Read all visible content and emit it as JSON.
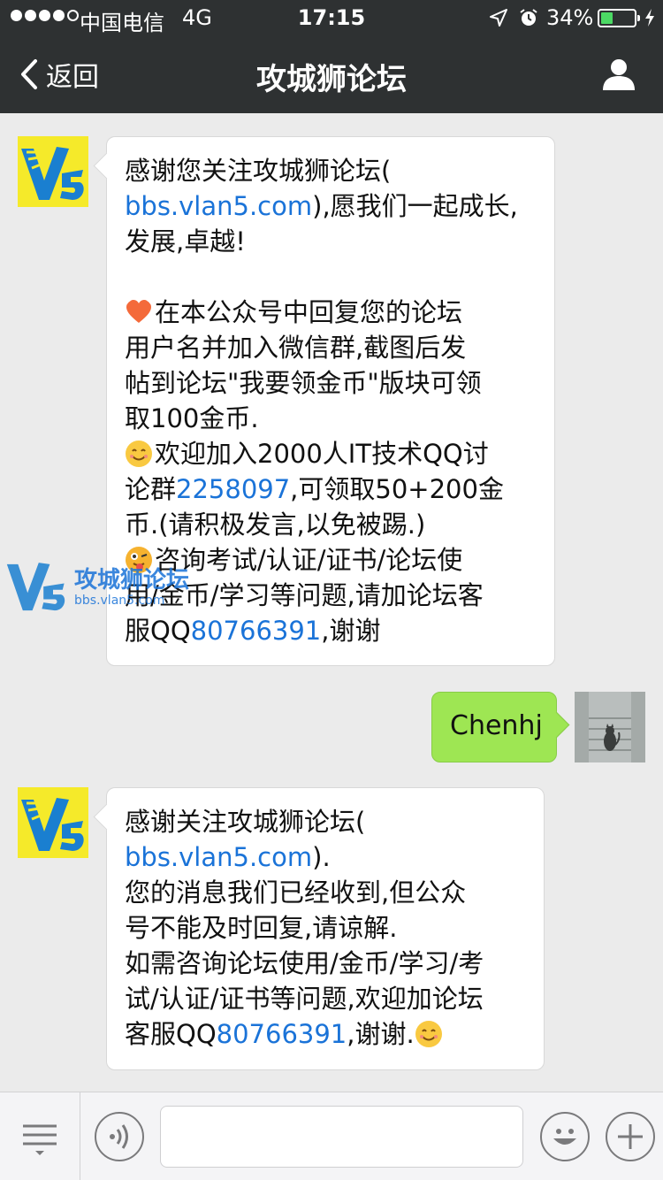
{
  "status_bar": {
    "carrier": "中国电信",
    "network": "4G",
    "time": "17:15",
    "battery_percent": "34%",
    "battery_level": 0.34,
    "battery_color": "#4cd964"
  },
  "nav": {
    "back_label": "返回",
    "title": "攻城狮论坛",
    "back_icon": "chevron-left-icon",
    "profile_icon": "person-icon"
  },
  "messages": {
    "msg1": {
      "sender": "official-account",
      "line1": "感谢您关注攻城狮论坛(",
      "line2_link": "bbs.vlan5.com",
      "line2_rest": "),愿我们一起成长,",
      "line3": "发展,卓越!",
      "p2_line1": "在本公众号中回复您的论坛",
      "p2_line2": "用户名并加入微信群,截图后发",
      "p2_line3": "帖到论坛\"我要领金币\"版块可领",
      "p2_line4": "取100金币.",
      "p3_line1": "欢迎加入2000人IT技术QQ讨",
      "p3_line2_pre": "论群",
      "p3_line2_link": "2258097",
      "p3_line2_rest": ",可领取50+200金",
      "p3_line3": "币.(请积极发言,以免被踢.)",
      "p4_line1": "咨询考试/认证/证书/论坛使",
      "p4_line2": "用/金币/学习等问题,请加论坛客",
      "p4_line3_pre": "服QQ",
      "p4_line3_link": "80766391",
      "p4_line3_rest": ",谢谢"
    },
    "msg2": {
      "sender": "me",
      "text": "Chenhj"
    },
    "msg3": {
      "sender": "official-account",
      "line1": "感谢关注攻城狮论坛(",
      "line2_link": "bbs.vlan5.com",
      "line2_rest": ").",
      "line3": "您的消息我们已经收到,但公众",
      "line4": "号不能及时回复,请谅解.",
      "line5": "如需咨询论坛使用/金币/学习/考",
      "line6": "试/认证/证书等问题,欢迎加论坛",
      "line7_pre": "客服QQ",
      "line7_link": "80766391",
      "line7_rest": ",谢谢."
    }
  },
  "watermark": {
    "title": "攻城狮论坛",
    "url": "bbs.vlan5.com"
  },
  "colors": {
    "bar_bg": "#2e3132",
    "chat_bg": "#ebebeb",
    "link": "#1a73d8",
    "my_bubble": "#9ee653",
    "avatar_yellow": "#f5ea2a"
  },
  "input_bar": {
    "menu_icon": "menu-list-icon",
    "voice_icon": "voice-icon",
    "emoji_icon": "emoji-icon",
    "plus_icon": "plus-icon"
  }
}
